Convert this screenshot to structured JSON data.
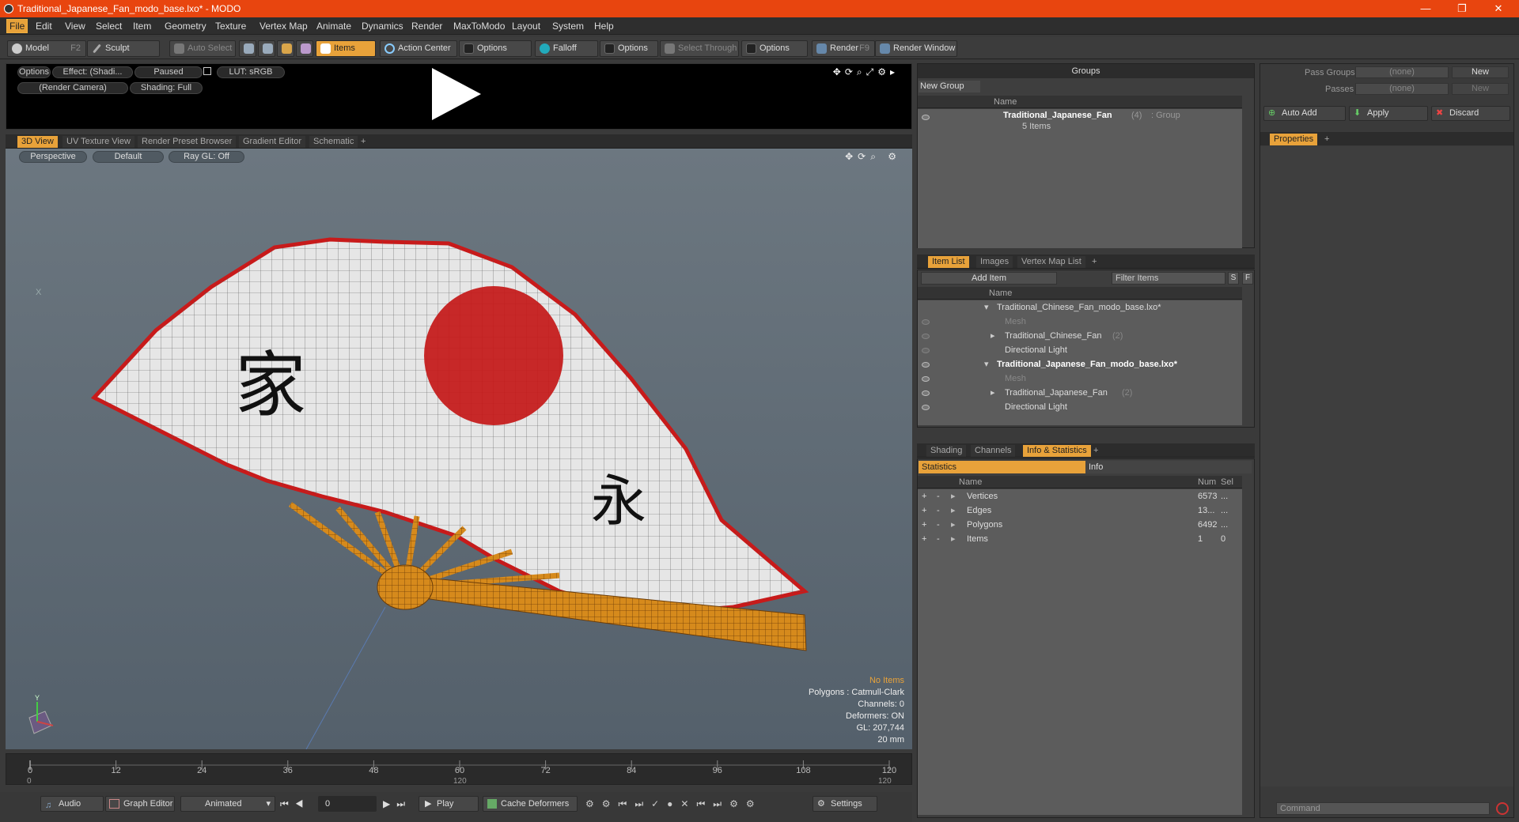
{
  "window": {
    "title": "Traditional_Japanese_Fan_modo_base.lxo* - MODO",
    "minimize": "—",
    "maximize": "❐",
    "close": "✕"
  },
  "menu": [
    "File",
    "Edit",
    "View",
    "Select",
    "Item",
    "Geometry",
    "Texture",
    "Vertex Map",
    "Animate",
    "Dynamics",
    "Render",
    "MaxToModo",
    "Layout",
    "System",
    "Help"
  ],
  "toolbar": {
    "model": "Model",
    "model_key": "F2",
    "sculpt": "Sculpt",
    "auto_select": "Auto Select",
    "items": "Items",
    "action_center": "Action Center",
    "options1": "Options",
    "falloff": "Falloff",
    "options2": "Options",
    "select_through": "Select Through",
    "options3": "Options",
    "render": "Render",
    "render_key": "F9",
    "render_window": "Render Window"
  },
  "preview": {
    "options": "Options",
    "effect": "Effect: (Shadi...",
    "paused": "Paused",
    "lut": "LUT: sRGB",
    "camera": "(Render Camera)",
    "shading": "Shading: Full"
  },
  "view_tabs": [
    "3D View",
    "UV Texture View",
    "Render Preset Browser",
    "Gradient Editor",
    "Schematic",
    "+"
  ],
  "viewport": {
    "perspective": "Perspective",
    "default": "Default",
    "raygl": "Ray GL: Off",
    "no_items": "No Items",
    "polygons": "Polygons : Catmull-Clark",
    "channels": "Channels: 0",
    "deformers": "Deformers: ON",
    "gl": "GL: 207,744",
    "scale": "20 mm",
    "axis_y": "Y",
    "axis_x": "X"
  },
  "timeline": {
    "ticks": [
      "0",
      "12",
      "24",
      "36",
      "48",
      "60",
      "72",
      "84",
      "96",
      "108",
      "120"
    ],
    "start": "0",
    "mid": "120",
    "end": "120"
  },
  "transport": {
    "audio": "Audio",
    "graph_editor": "Graph Editor",
    "animated": "Animated",
    "frame": "0",
    "play": "Play",
    "cache": "Cache Deformers",
    "settings": "Settings"
  },
  "groups": {
    "title": "Groups",
    "new_group": "New Group",
    "col_name": "Name",
    "group_name": "Traditional_Japanese_Fan",
    "group_count": "(4)",
    "group_type": ": Group",
    "group_items": "5 Items"
  },
  "item_tabs": [
    "Item List",
    "Images",
    "Vertex Map List",
    "+"
  ],
  "item_list": {
    "add_item": "Add Item",
    "filter": "Filter Items",
    "s": "S",
    "f": "F",
    "col_name": "Name",
    "rows": [
      {
        "label": "Traditional_Chinese_Fan_modo_base.lxo*",
        "indent": 0,
        "bold": false,
        "dim": false,
        "count": ""
      },
      {
        "label": "Mesh",
        "indent": 1,
        "bold": false,
        "dim": true,
        "count": ""
      },
      {
        "label": "Traditional_Chinese_Fan",
        "indent": 1,
        "bold": false,
        "dim": false,
        "count": "(2)"
      },
      {
        "label": "Directional Light",
        "indent": 1,
        "bold": false,
        "dim": false,
        "count": ""
      },
      {
        "label": "Traditional_Japanese_Fan_modo_base.lxo*",
        "indent": 0,
        "bold": true,
        "dim": false,
        "count": ""
      },
      {
        "label": "Mesh",
        "indent": 1,
        "bold": false,
        "dim": true,
        "count": ""
      },
      {
        "label": "Traditional_Japanese_Fan",
        "indent": 1,
        "bold": false,
        "dim": false,
        "count": "(2)"
      },
      {
        "label": "Directional Light",
        "indent": 1,
        "bold": false,
        "dim": false,
        "count": ""
      }
    ]
  },
  "info_tabs": [
    "Shading",
    "Channels",
    "Info & Statistics",
    "+"
  ],
  "stats": {
    "statistics": "Statistics",
    "info": "Info",
    "col_name": "Name",
    "col_num": "Num",
    "col_sel": "Sel",
    "rows": [
      {
        "name": "Vertices",
        "num": "6573",
        "sel": "..."
      },
      {
        "name": "Edges",
        "num": "13...",
        "sel": "..."
      },
      {
        "name": "Polygons",
        "num": "6492",
        "sel": "..."
      },
      {
        "name": "Items",
        "num": "1",
        "sel": "0"
      }
    ]
  },
  "right": {
    "pass_groups": "Pass Groups",
    "passes": "Passes",
    "none1": "(none)",
    "none2": "(none)",
    "new1": "New",
    "new2": "New",
    "auto_add": "Auto Add",
    "apply": "Apply",
    "discard": "Discard",
    "properties": "Properties",
    "plus": "+",
    "command": "Command"
  },
  "colors": {
    "accent": "#e8a23a",
    "titlebar": "#e8450f"
  }
}
